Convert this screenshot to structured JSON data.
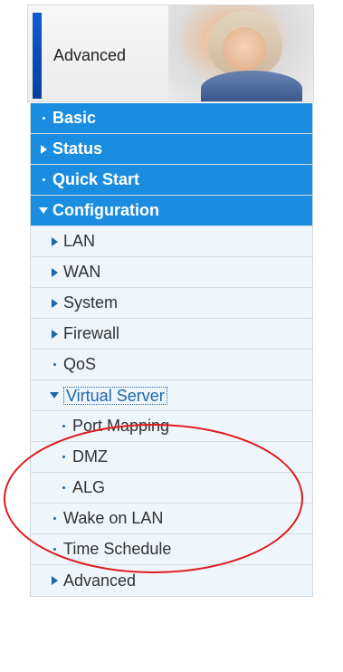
{
  "app": {
    "header_title": "Advanced"
  },
  "colors": {
    "accent": "#1b8de0",
    "submenu_bg": "#eef5fb",
    "submenu_text": "#333333",
    "icon_blue": "#1d67a8",
    "highlight": "#e11a1a"
  },
  "menu": {
    "items": [
      {
        "label": "Basic",
        "icon": "bullet-icon"
      },
      {
        "label": "Status",
        "icon": "triangle-right-icon"
      },
      {
        "label": "Quick Start",
        "icon": "bullet-icon"
      },
      {
        "label": "Configuration",
        "icon": "triangle-down-icon"
      },
      {
        "label": "LAN",
        "icon": "triangle-right-icon"
      },
      {
        "label": "WAN",
        "icon": "triangle-right-icon"
      },
      {
        "label": "System",
        "icon": "triangle-right-icon"
      },
      {
        "label": "Firewall",
        "icon": "triangle-right-icon"
      },
      {
        "label": "QoS",
        "icon": "bullet-icon"
      },
      {
        "label": "Virtual Server",
        "icon": "triangle-down-icon"
      },
      {
        "label": "Port Mapping",
        "icon": "bullet-icon"
      },
      {
        "label": "DMZ",
        "icon": "bullet-icon"
      },
      {
        "label": "ALG",
        "icon": "bullet-icon"
      },
      {
        "label": "Wake on LAN",
        "icon": "bullet-icon"
      },
      {
        "label": "Time Schedule",
        "icon": "bullet-icon"
      },
      {
        "label": "Advanced",
        "icon": "triangle-right-icon"
      }
    ]
  }
}
